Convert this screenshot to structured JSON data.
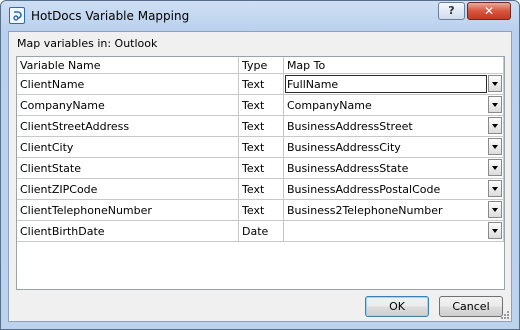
{
  "window": {
    "title": "HotDocs Variable Mapping",
    "icon": "hotdocs-icon"
  },
  "header": {
    "map_label": "Map variables in: Outlook"
  },
  "columns": [
    "Variable Name",
    "Type",
    "Map To"
  ],
  "rows": [
    {
      "name": "ClientName",
      "type": "Text",
      "map_to": "FullName"
    },
    {
      "name": "CompanyName",
      "type": "Text",
      "map_to": "CompanyName"
    },
    {
      "name": "ClientStreetAddress",
      "type": "Text",
      "map_to": "BusinessAddressStreet"
    },
    {
      "name": "ClientCity",
      "type": "Text",
      "map_to": "BusinessAddressCity"
    },
    {
      "name": "ClientState",
      "type": "Text",
      "map_to": "BusinessAddressState"
    },
    {
      "name": "ClientZIPCode",
      "type": "Text",
      "map_to": "BusinessAddressPostalCode"
    },
    {
      "name": "ClientTelephoneNumber",
      "type": "Text",
      "map_to": "Business2TelephoneNumber"
    },
    {
      "name": "ClientBirthDate",
      "type": "Date",
      "map_to": ""
    }
  ],
  "buttons": {
    "ok": "OK",
    "cancel": "Cancel"
  },
  "titlebar_buttons": {
    "help": "?",
    "close": "✕"
  },
  "colors": {
    "title_bar": "#b9d1ee",
    "close_button": "#c13a22",
    "dialog_bg": "#f0f0f0"
  }
}
